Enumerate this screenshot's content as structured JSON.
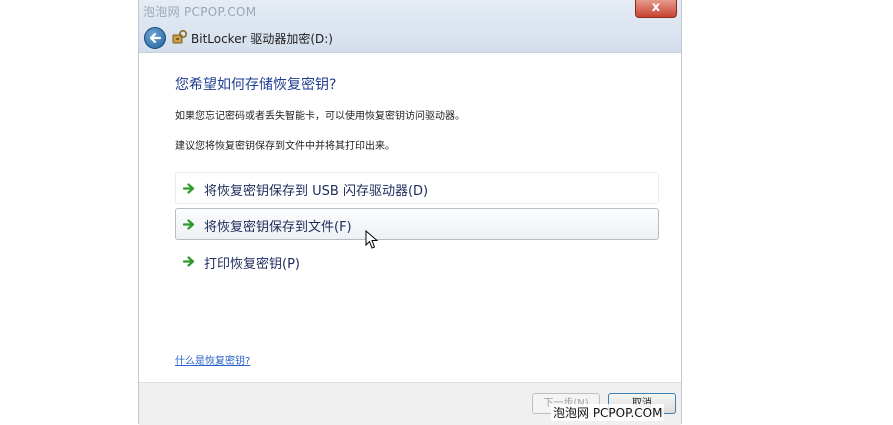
{
  "watermark": {
    "top": "泡泡网 PCPOP.COM",
    "bottom": "泡泡网 PCPOP.COM"
  },
  "titlebar": {
    "title": "BitLocker 驱动器加密(D:)",
    "close_label": "x",
    "ghost_title": "",
    "icons": [
      "back-arrow-icon",
      "bitlocker-key-icon"
    ]
  },
  "main": {
    "heading": "您希望如何存储恢复密钥?",
    "description_1": "如果您忘记密码或者丢失智能卡，可以使用恢复密钥访问驱动器。",
    "description_2": "建议您将恢复密钥保存到文件中并将其打印出来。",
    "options": [
      {
        "label": "将恢复密钥保存到 USB 闪存驱动器(D)",
        "icon": "green-arrow-icon"
      },
      {
        "label": "将恢复密钥保存到文件(F)",
        "icon": "green-arrow-icon"
      },
      {
        "label": "打印恢复密钥(P)",
        "icon": "green-arrow-icon"
      }
    ],
    "help_link": "什么是恢复密钥?"
  },
  "footer": {
    "next_label": "下一步(N)",
    "cancel_label": "取消"
  },
  "colors": {
    "heading": "#1f3d91",
    "link": "#2a62c9",
    "close": "#c6432f",
    "arrow": "#2e9a2e"
  }
}
